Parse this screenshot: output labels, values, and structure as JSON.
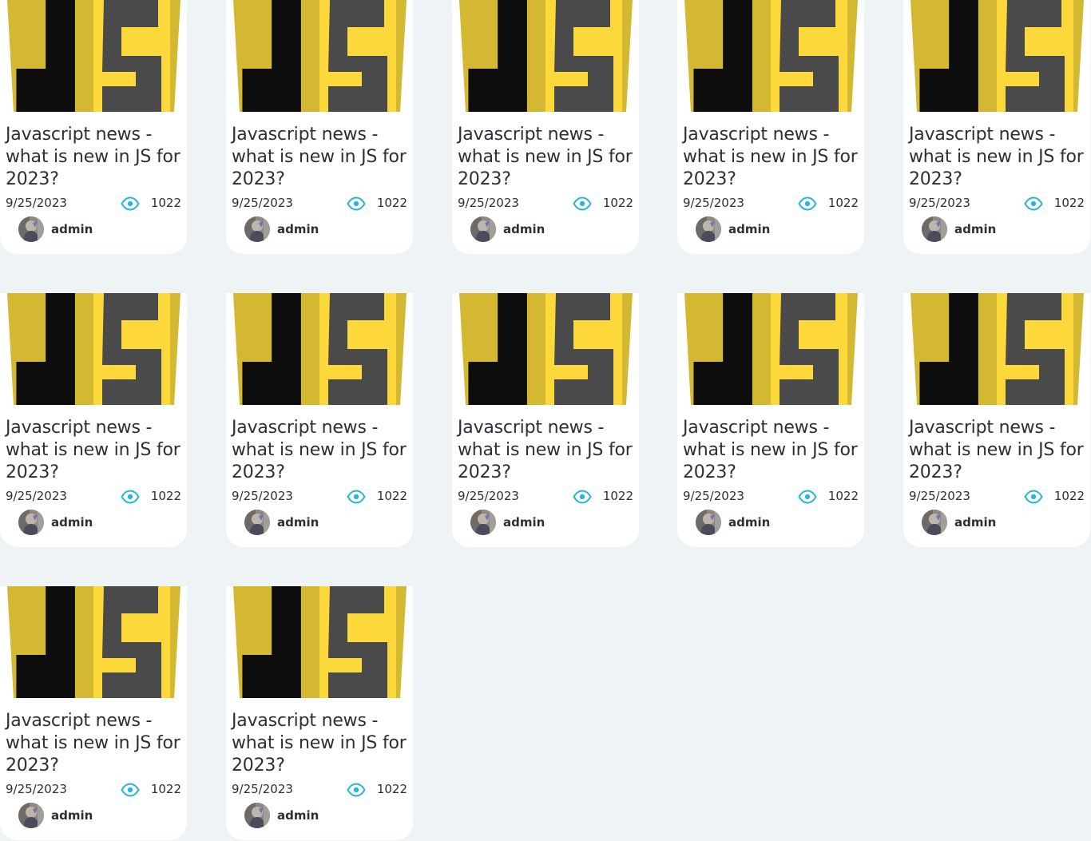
{
  "colors": {
    "background": "#eef3f6",
    "card": "#ffffff",
    "logo_gold": "#d4b832",
    "logo_yellow": "#fdd83a",
    "logo_black": "#0d0d0d",
    "logo_gray": "#4a4a4a",
    "eye_icon": "#29b6d8"
  },
  "icons": {
    "thumbnail": "javascript-logo-icon",
    "views": "eye-icon",
    "author": "avatar"
  },
  "posts": [
    {
      "title": "Javascript news - what is new in JS for 2023?",
      "date": "9/25/2023",
      "views": "1022",
      "author": "admin"
    },
    {
      "title": "Javascript news - what is new in JS for 2023?",
      "date": "9/25/2023",
      "views": "1022",
      "author": "admin"
    },
    {
      "title": "Javascript news - what is new in JS for 2023?",
      "date": "9/25/2023",
      "views": "1022",
      "author": "admin"
    },
    {
      "title": "Javascript news - what is new in JS for 2023?",
      "date": "9/25/2023",
      "views": "1022",
      "author": "admin"
    },
    {
      "title": "Javascript news - what is new in JS for 2023?",
      "date": "9/25/2023",
      "views": "1022",
      "author": "admin"
    },
    {
      "title": "Javascript news - what is new in JS for 2023?",
      "date": "9/25/2023",
      "views": "1022",
      "author": "admin"
    },
    {
      "title": "Javascript news - what is new in JS for 2023?",
      "date": "9/25/2023",
      "views": "1022",
      "author": "admin"
    },
    {
      "title": "Javascript news - what is new in JS for 2023?",
      "date": "9/25/2023",
      "views": "1022",
      "author": "admin"
    },
    {
      "title": "Javascript news - what is new in JS for 2023?",
      "date": "9/25/2023",
      "views": "1022",
      "author": "admin"
    },
    {
      "title": "Javascript news - what is new in JS for 2023?",
      "date": "9/25/2023",
      "views": "1022",
      "author": "admin"
    },
    {
      "title": "Javascript news - what is new in JS for 2023?",
      "date": "9/25/2023",
      "views": "1022",
      "author": "admin"
    },
    {
      "title": "Javascript news - what is new in JS for 2023?",
      "date": "9/25/2023",
      "views": "1022",
      "author": "admin"
    }
  ]
}
